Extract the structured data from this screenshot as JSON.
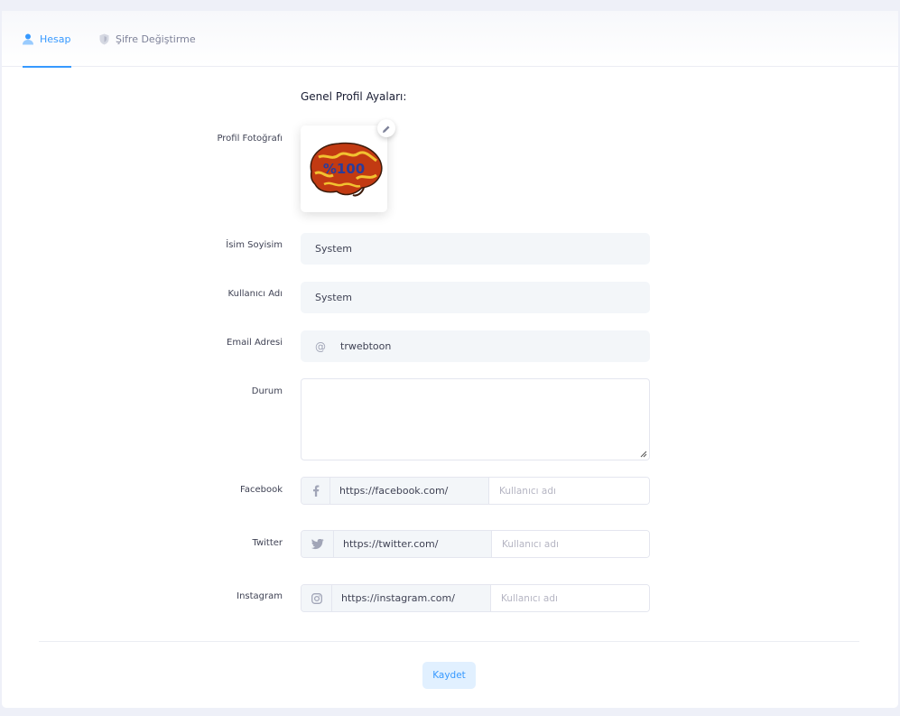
{
  "tabs": [
    {
      "label": "Hesap",
      "icon": "user-icon",
      "active": true
    },
    {
      "label": "Şifre Değiştirme",
      "icon": "shield-icon",
      "active": false
    }
  ],
  "section_title": "Genel Profil Ayaları:",
  "labels": {
    "photo": "Profil Fotoğrafı",
    "fullname": "İsim Soyisim",
    "username": "Kullanıcı Adı",
    "email": "Email Adresi",
    "status": "Durum",
    "facebook": "Facebook",
    "twitter": "Twitter",
    "instagram": "Instagram"
  },
  "avatar": {
    "image_text": "%100",
    "edit_icon": "pencil-icon"
  },
  "fields": {
    "fullname": "System",
    "username": "System",
    "email_prefix": "@",
    "email": "trwebtoon",
    "status": ""
  },
  "social": {
    "facebook": {
      "icon": "facebook-icon",
      "url": "https://facebook.com/",
      "placeholder": "Kullanıcı adı"
    },
    "twitter": {
      "icon": "twitter-icon",
      "url": "https://twitter.com/",
      "placeholder": "Kullanıcı adı"
    },
    "instagram": {
      "icon": "instagram-icon",
      "url": "https://instagram.com/",
      "placeholder": "Kullanıcı adı"
    }
  },
  "save_label": "Kaydet",
  "colors": {
    "accent": "#3699ff",
    "field_bg": "#f3f6f9",
    "button_bg": "#e1f0ff"
  }
}
